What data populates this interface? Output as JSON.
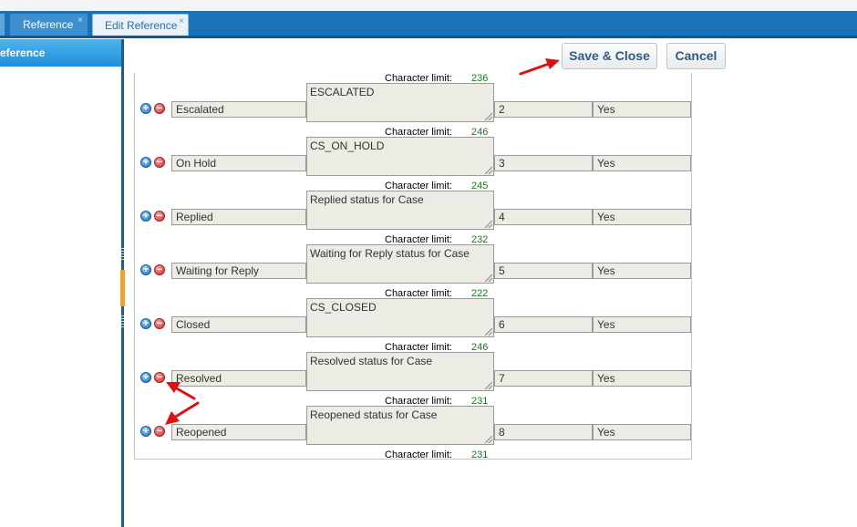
{
  "tabs": [
    {
      "label": "Reference",
      "close": "×"
    },
    {
      "label": "Edit Reference",
      "close": "×"
    }
  ],
  "sidebar": {
    "heading": "eference"
  },
  "toolbar": {
    "save_label": "Save & Close",
    "cancel_label": "Cancel"
  },
  "form": {
    "char_limit_label": "Character limit:",
    "add_symbol": "+",
    "remove_symbol": "−",
    "top_char_limit": "236",
    "rows": [
      {
        "name": "Escalated",
        "description": "ESCALATED",
        "sequence": "2",
        "active": "Yes",
        "char_limit_after": "246"
      },
      {
        "name": "On Hold",
        "description": "CS_ON_HOLD",
        "sequence": "3",
        "active": "Yes",
        "char_limit_after": "245"
      },
      {
        "name": "Replied",
        "description": "Replied status for Case",
        "sequence": "4",
        "active": "Yes",
        "char_limit_after": "232"
      },
      {
        "name": "Waiting for Reply",
        "description": "Waiting for Reply status for Case",
        "sequence": "5",
        "active": "Yes",
        "char_limit_after": "222"
      },
      {
        "name": "Closed",
        "description": "CS_CLOSED",
        "sequence": "6",
        "active": "Yes",
        "char_limit_after": "246"
      },
      {
        "name": "Resolved",
        "description": "Resolved status for Case",
        "sequence": "7",
        "active": "Yes",
        "char_limit_after": "231"
      },
      {
        "name": "Reopened",
        "description": "Reopened status for Case",
        "sequence": "8",
        "active": "Yes",
        "char_limit_after": "231"
      }
    ]
  },
  "colors": {
    "tabbar": "#1a72b8",
    "char_limit_number": "#1a7a1a",
    "annotation_arrow": "#e01010",
    "add_icon": "#1d6fc4",
    "remove_icon": "#d12c2c"
  }
}
